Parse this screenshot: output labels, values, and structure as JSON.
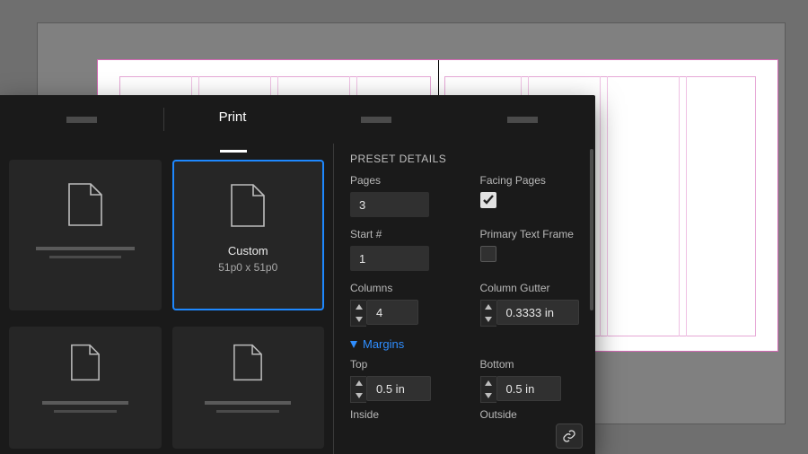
{
  "tabs": {
    "active": "Print"
  },
  "gallery": {
    "selected": {
      "label": "Custom",
      "size": "51p0 x 51p0"
    }
  },
  "details": {
    "title": "PRESET DETAILS",
    "pages": {
      "label": "Pages",
      "value": "3"
    },
    "facing": {
      "label": "Facing Pages",
      "checked": true
    },
    "start": {
      "label": "Start #",
      "value": "1"
    },
    "primaryTF": {
      "label": "Primary Text Frame",
      "checked": false
    },
    "columns": {
      "label": "Columns",
      "value": "4"
    },
    "gutter": {
      "label": "Column Gutter",
      "value": "0.3333 in"
    },
    "marginsHeader": "Margins",
    "top": {
      "label": "Top",
      "value": "0.5 in"
    },
    "bottom": {
      "label": "Bottom",
      "value": "0.5 in"
    },
    "inside": {
      "label": "Inside"
    },
    "outside": {
      "label": "Outside"
    }
  }
}
